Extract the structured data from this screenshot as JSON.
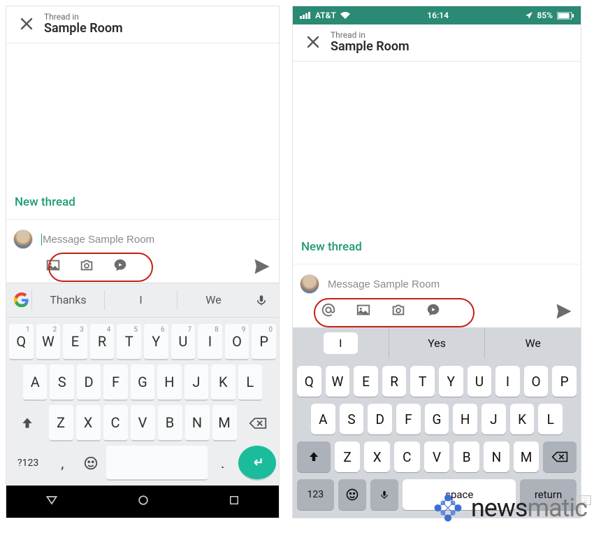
{
  "android": {
    "header": {
      "thread_in": "Thread in",
      "room": "Sample Room"
    },
    "new_thread": "New thread",
    "compose": {
      "placeholder": "Message Sample Room"
    },
    "toolbar": [
      "image-icon",
      "camera-icon",
      "video-chat-icon"
    ],
    "suggestions": [
      "Thanks",
      "I",
      "We"
    ],
    "keyboard": {
      "row1": [
        [
          "Q",
          "1"
        ],
        [
          "W",
          "2"
        ],
        [
          "E",
          "3"
        ],
        [
          "R",
          "4"
        ],
        [
          "T",
          "5"
        ],
        [
          "Y",
          "6"
        ],
        [
          "U",
          "7"
        ],
        [
          "I",
          "8"
        ],
        [
          "O",
          "9"
        ],
        [
          "P",
          "0"
        ]
      ],
      "row2": [
        "A",
        "S",
        "D",
        "F",
        "G",
        "H",
        "J",
        "K",
        "L"
      ],
      "row3": [
        "Z",
        "X",
        "C",
        "V",
        "B",
        "N",
        "M"
      ],
      "bottom": {
        "symbols": "?123",
        "comma": ",",
        "dot": ".",
        "enter": "↵"
      }
    }
  },
  "ios": {
    "statusbar": {
      "carrier": "AT&T",
      "time": "16:14",
      "battery": "85%"
    },
    "header": {
      "thread_in": "Thread in",
      "room": "Sample Room"
    },
    "new_thread": "New thread",
    "compose": {
      "placeholder": "Message Sample Room"
    },
    "toolbar": [
      "mention-icon",
      "image-icon",
      "camera-icon",
      "video-chat-icon"
    ],
    "suggestions": [
      "I",
      "Yes",
      "We"
    ],
    "keyboard": {
      "row1": [
        "Q",
        "W",
        "E",
        "R",
        "T",
        "Y",
        "U",
        "I",
        "O",
        "P"
      ],
      "row2": [
        "A",
        "S",
        "D",
        "F",
        "G",
        "H",
        "J",
        "K",
        "L"
      ],
      "row3": [
        "Z",
        "X",
        "C",
        "V",
        "B",
        "N",
        "M"
      ],
      "bottom": {
        "numbers": "123",
        "space": "space",
        "return": "return"
      }
    }
  },
  "watermark": {
    "brand_a": "news",
    "brand_b": "matic"
  }
}
